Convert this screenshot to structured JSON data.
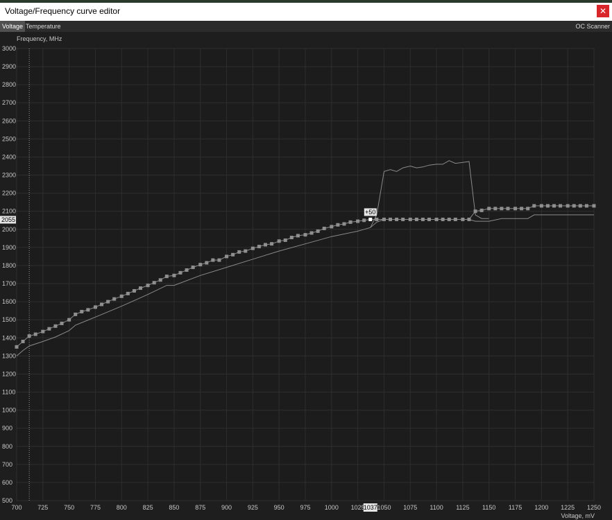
{
  "window": {
    "title": "Voltage/Frequency curve editor",
    "close_icon": "close-icon"
  },
  "tabs": [
    {
      "label": "Voltage",
      "active": true
    },
    {
      "label": "Temperature",
      "active": false
    }
  ],
  "oc_scanner_label": "OC Scanner",
  "chart_data": {
    "type": "line",
    "ylabel": "Frequency, MHz",
    "xlabel": "Voltage, mV",
    "xlim": [
      700,
      1250
    ],
    "ylim": [
      500,
      3000
    ],
    "x_ticks": [
      700,
      725,
      750,
      775,
      800,
      825,
      850,
      875,
      900,
      925,
      950,
      975,
      1000,
      1025,
      1050,
      1075,
      1100,
      1125,
      1150,
      1175,
      1200,
      1225,
      1250
    ],
    "y_ticks": [
      500,
      600,
      700,
      800,
      900,
      1000,
      1100,
      1200,
      1300,
      1400,
      1500,
      1600,
      1700,
      1800,
      1900,
      2000,
      2100,
      2200,
      2300,
      2400,
      2500,
      2600,
      2700,
      2800,
      2900,
      3000
    ],
    "grid": true,
    "selected_point": {
      "voltage": 1037,
      "frequency": 2055,
      "offset_label": "+50",
      "voltage_label": "1037",
      "frequency_label": "2055"
    },
    "cursor_voltage": 712,
    "curve_points": [
      [
        700,
        1350
      ],
      [
        706,
        1380
      ],
      [
        712,
        1410
      ],
      [
        718,
        1420
      ],
      [
        725,
        1435
      ],
      [
        731,
        1450
      ],
      [
        737,
        1465
      ],
      [
        743,
        1480
      ],
      [
        750,
        1500
      ],
      [
        756,
        1530
      ],
      [
        762,
        1545
      ],
      [
        768,
        1555
      ],
      [
        775,
        1570
      ],
      [
        781,
        1585
      ],
      [
        787,
        1600
      ],
      [
        793,
        1615
      ],
      [
        800,
        1630
      ],
      [
        806,
        1645
      ],
      [
        812,
        1660
      ],
      [
        818,
        1675
      ],
      [
        825,
        1690
      ],
      [
        831,
        1705
      ],
      [
        837,
        1720
      ],
      [
        843,
        1740
      ],
      [
        850,
        1745
      ],
      [
        856,
        1760
      ],
      [
        862,
        1775
      ],
      [
        868,
        1790
      ],
      [
        875,
        1805
      ],
      [
        881,
        1815
      ],
      [
        887,
        1830
      ],
      [
        893,
        1830
      ],
      [
        900,
        1850
      ],
      [
        906,
        1860
      ],
      [
        912,
        1875
      ],
      [
        918,
        1880
      ],
      [
        925,
        1895
      ],
      [
        931,
        1905
      ],
      [
        937,
        1915
      ],
      [
        943,
        1920
      ],
      [
        950,
        1935
      ],
      [
        956,
        1940
      ],
      [
        962,
        1955
      ],
      [
        968,
        1965
      ],
      [
        975,
        1970
      ],
      [
        981,
        1980
      ],
      [
        987,
        1990
      ],
      [
        993,
        2005
      ],
      [
        1000,
        2015
      ],
      [
        1006,
        2025
      ],
      [
        1012,
        2030
      ],
      [
        1018,
        2040
      ],
      [
        1025,
        2045
      ],
      [
        1031,
        2050
      ],
      [
        1037,
        2055
      ],
      [
        1043,
        2055
      ],
      [
        1050,
        2055
      ],
      [
        1056,
        2055
      ],
      [
        1062,
        2055
      ],
      [
        1068,
        2055
      ],
      [
        1075,
        2055
      ],
      [
        1081,
        2055
      ],
      [
        1087,
        2055
      ],
      [
        1093,
        2055
      ],
      [
        1100,
        2055
      ],
      [
        1106,
        2055
      ],
      [
        1112,
        2055
      ],
      [
        1118,
        2055
      ],
      [
        1125,
        2055
      ],
      [
        1131,
        2055
      ],
      [
        1137,
        2100
      ],
      [
        1143,
        2105
      ],
      [
        1150,
        2115
      ],
      [
        1156,
        2115
      ],
      [
        1162,
        2115
      ],
      [
        1168,
        2115
      ],
      [
        1175,
        2115
      ],
      [
        1181,
        2115
      ],
      [
        1187,
        2115
      ],
      [
        1193,
        2130
      ],
      [
        1200,
        2130
      ],
      [
        1206,
        2130
      ],
      [
        1212,
        2130
      ],
      [
        1218,
        2130
      ],
      [
        1225,
        2130
      ],
      [
        1231,
        2130
      ],
      [
        1237,
        2130
      ],
      [
        1243,
        2130
      ],
      [
        1250,
        2130
      ]
    ],
    "default_curve": [
      [
        700,
        1300
      ],
      [
        706,
        1330
      ],
      [
        712,
        1355
      ],
      [
        725,
        1380
      ],
      [
        737,
        1405
      ],
      [
        750,
        1440
      ],
      [
        756,
        1470
      ],
      [
        775,
        1515
      ],
      [
        800,
        1575
      ],
      [
        825,
        1640
      ],
      [
        843,
        1690
      ],
      [
        850,
        1690
      ],
      [
        875,
        1745
      ],
      [
        900,
        1790
      ],
      [
        925,
        1835
      ],
      [
        950,
        1880
      ],
      [
        975,
        1920
      ],
      [
        1000,
        1960
      ],
      [
        1025,
        1990
      ],
      [
        1031,
        2000
      ],
      [
        1037,
        2010
      ],
      [
        1043,
        2040
      ],
      [
        1050,
        2055
      ],
      [
        1131,
        2055
      ],
      [
        1137,
        2045
      ],
      [
        1150,
        2045
      ],
      [
        1162,
        2060
      ],
      [
        1175,
        2060
      ],
      [
        1187,
        2060
      ],
      [
        1193,
        2080
      ],
      [
        1250,
        2080
      ]
    ],
    "scanner_curve": [
      [
        1037,
        2010
      ],
      [
        1043,
        2080
      ],
      [
        1050,
        2320
      ],
      [
        1056,
        2330
      ],
      [
        1062,
        2320
      ],
      [
        1068,
        2340
      ],
      [
        1075,
        2350
      ],
      [
        1081,
        2340
      ],
      [
        1087,
        2345
      ],
      [
        1093,
        2355
      ],
      [
        1100,
        2360
      ],
      [
        1106,
        2360
      ],
      [
        1112,
        2380
      ],
      [
        1118,
        2365
      ],
      [
        1125,
        2370
      ],
      [
        1131,
        2375
      ],
      [
        1137,
        2080
      ],
      [
        1143,
        2060
      ],
      [
        1150,
        2060
      ]
    ]
  }
}
